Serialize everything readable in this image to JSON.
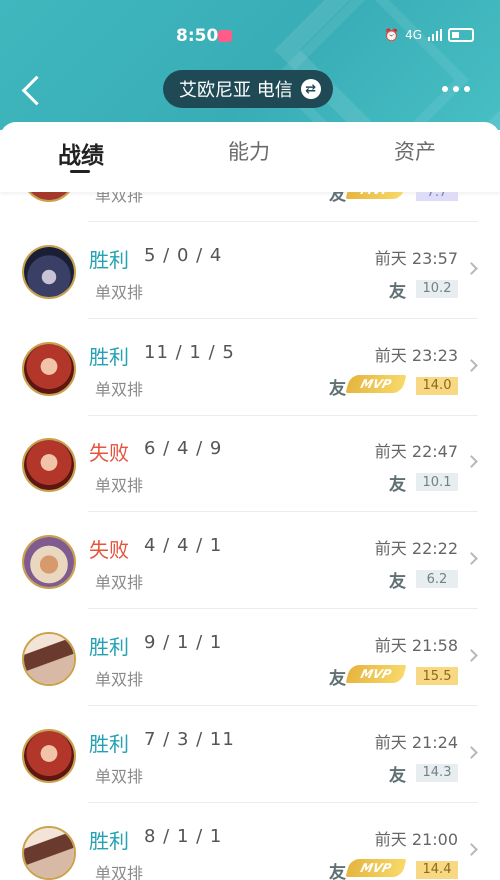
{
  "status_bar": {
    "time": "8:50",
    "network": "4G"
  },
  "nav": {
    "server_label": "艾欧尼亚 电信",
    "swap_icon": "swap-icon",
    "more_icon": "more-icon",
    "back_icon": "chevron-left-icon"
  },
  "tabs": [
    {
      "label": "战绩",
      "active": true
    },
    {
      "label": "能力",
      "active": false
    },
    {
      "label": "资产",
      "active": false
    }
  ],
  "colors": {
    "header": "#3fb7bd",
    "win": "#24a2b4",
    "loss": "#e5533d",
    "mvp": "#f0c44e"
  },
  "matches": [
    {
      "result": "",
      "kda": "",
      "mode": "单双排",
      "time": "",
      "friend": "友",
      "mvp": true,
      "score": "7.7",
      "score_style": "purple",
      "partial": true
    },
    {
      "result": "胜利",
      "kda": "5 / 0 / 4",
      "mode": "单双排",
      "time": "前天 23:57",
      "friend": "友",
      "mvp": false,
      "score": "10.2",
      "score_style": "plain",
      "avatar": "hooded"
    },
    {
      "result": "胜利",
      "kda": "11 / 1 / 5",
      "mode": "单双排",
      "time": "前天 23:23",
      "friend": "友",
      "mvp": true,
      "score": "14.0",
      "score_style": "gold",
      "avatar": "red"
    },
    {
      "result": "失败",
      "kda": "6 / 4 / 9",
      "mode": "单双排",
      "time": "前天 22:47",
      "friend": "友",
      "mvp": false,
      "score": "10.1",
      "score_style": "plain",
      "avatar": "red"
    },
    {
      "result": "失败",
      "kda": "4 / 4 / 1",
      "mode": "单双排",
      "time": "前天 22:22",
      "friend": "友",
      "mvp": false,
      "score": "6.2",
      "score_style": "plain",
      "avatar": "dancer"
    },
    {
      "result": "胜利",
      "kda": "9 / 1 / 1",
      "mode": "单双排",
      "time": "前天 21:58",
      "friend": "友",
      "mvp": true,
      "score": "15.5",
      "score_style": "gold",
      "avatar": "blade"
    },
    {
      "result": "胜利",
      "kda": "7 / 3 / 11",
      "mode": "单双排",
      "time": "前天 21:24",
      "friend": "友",
      "mvp": false,
      "score": "14.3",
      "score_style": "plain",
      "avatar": "red"
    },
    {
      "result": "胜利",
      "kda": "8 / 1 / 1",
      "mode": "单双排",
      "time": "前天 21:00",
      "friend": "友",
      "mvp": true,
      "score": "14.4",
      "score_style": "gold",
      "avatar": "blade"
    }
  ],
  "mvp_label": "MVP"
}
